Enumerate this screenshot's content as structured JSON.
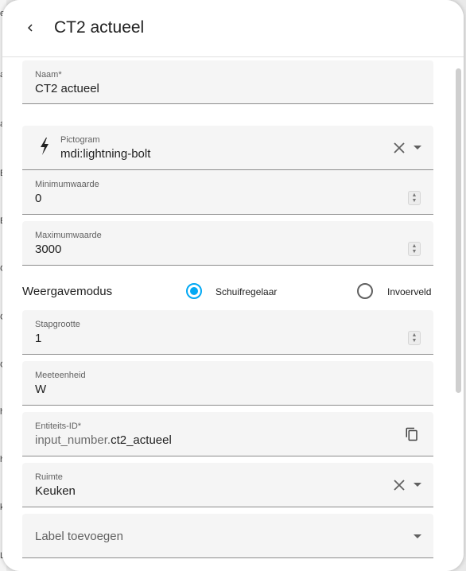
{
  "background": {
    "letters": [
      "e",
      "a",
      "a",
      "E",
      "E",
      "G",
      "G",
      "G",
      "h",
      "h",
      "k",
      "L"
    ]
  },
  "header": {
    "title": "CT2 actueel"
  },
  "fields": {
    "name": {
      "label": "Naam*",
      "value": "CT2 actueel"
    },
    "icon": {
      "label": "Pictogram",
      "value": "mdi:lightning-bolt"
    },
    "min": {
      "label": "Minimumwaarde",
      "value": "0"
    },
    "max": {
      "label": "Maximumwaarde",
      "value": "3000"
    },
    "mode": {
      "label": "Weergavemodus",
      "options": [
        "Schuifregelaar",
        "Invoerveld"
      ],
      "selected": "Schuifregelaar"
    },
    "step": {
      "label": "Stapgrootte",
      "value": "1"
    },
    "unit": {
      "label": "Meeteenheid",
      "value": "W"
    },
    "entity_id": {
      "label": "Entiteits-ID*",
      "prefix": "input_number.",
      "value": "ct2_actueel"
    },
    "area": {
      "label": "Ruimte",
      "value": "Keuken"
    },
    "labels": {
      "placeholder": "Label toevoegen"
    }
  },
  "colors": {
    "accent": "#03a9f4",
    "field_bg": "#f5f5f5"
  },
  "icons": {
    "back": "chevron-left-icon",
    "pictogram": "lightning-bolt-icon",
    "clear": "close-icon",
    "dropdown": "menu-down-icon",
    "copy": "content-copy-icon"
  }
}
